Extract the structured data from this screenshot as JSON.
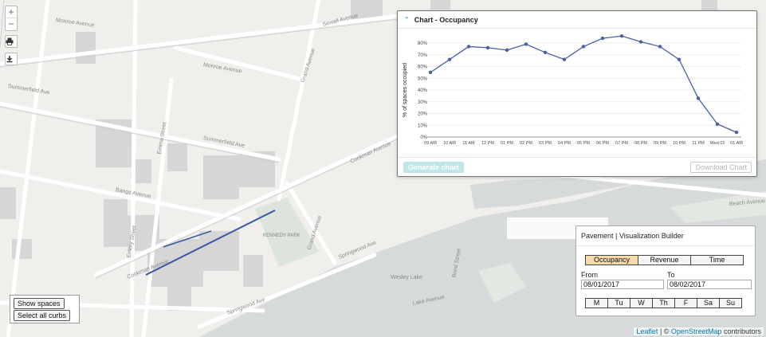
{
  "map": {
    "zoom_in": "+",
    "zoom_out": "−",
    "print_icon": "print-icon",
    "download_icon": "download-icon",
    "street_labels": [
      "Monroe Avenue",
      "Monroe Avenue",
      "Sewall Avenue",
      "Grand Avenue",
      "Summerfield Ave",
      "Summerfield Ave",
      "Emma Street",
      "Bangs Avenue",
      "Cookman Avenue",
      "Cookman Avenue",
      "Grand Avenue",
      "Springwood Ave",
      "Springwood Ave",
      "Beach Avenue",
      "Lake Avenue",
      "Bond Street",
      "Emory Street",
      "Wesley Lake",
      "KENNEDY PARK"
    ],
    "show_spaces": "Show spaces",
    "select_all_curbs": "Select all curbs",
    "attribution_leaflet": "Leaflet",
    "attribution_sep": " | © ",
    "attribution_osm": "OpenStreetMap",
    "attribution_tail": " contributors",
    "colors": {
      "selected_curb": "#3a56a3",
      "water": "#d7dadb",
      "park": "#dde4dc",
      "building": "#d6d6d6"
    }
  },
  "chart_panel": {
    "title": "Chart - Occupancy",
    "collapse_icon": "chevron-up-icon",
    "generate_label": "Generate chart",
    "download_label": "Download Chart"
  },
  "chart_data": {
    "type": "line",
    "title": "",
    "xlabel": "",
    "ylabel": "% of spaces occupied",
    "categories": [
      "09 AM",
      "10 AM",
      "11 AM",
      "12 PM",
      "01 PM",
      "02 PM",
      "03 PM",
      "04 PM",
      "05 PM",
      "06 PM",
      "07 PM",
      "08 PM",
      "09 PM",
      "10 PM",
      "11 PM",
      "Wed 02",
      "01 AM"
    ],
    "values": [
      55,
      66,
      77,
      76,
      74,
      79,
      72,
      66,
      77,
      84,
      86,
      81,
      77,
      66,
      33,
      11,
      4
    ],
    "yticks": [
      "0%",
      "10%",
      "20%",
      "30%",
      "40%",
      "50%",
      "60%",
      "70%",
      "80%"
    ],
    "ylim": [
      0,
      80
    ],
    "line_color": "#4a5fa8",
    "grid": "horizontal"
  },
  "builder": {
    "title": "Pavement | Visualization Builder",
    "metrics": [
      {
        "label": "Occupancy",
        "active": true
      },
      {
        "label": "Revenue",
        "active": false
      },
      {
        "label": "Time",
        "active": false
      }
    ],
    "from_label": "From",
    "to_label": "To",
    "from_value": "08/01/2017",
    "to_value": "08/02/2017",
    "days": [
      "M",
      "Tu",
      "W",
      "Th",
      "F",
      "Sa",
      "Su"
    ]
  }
}
